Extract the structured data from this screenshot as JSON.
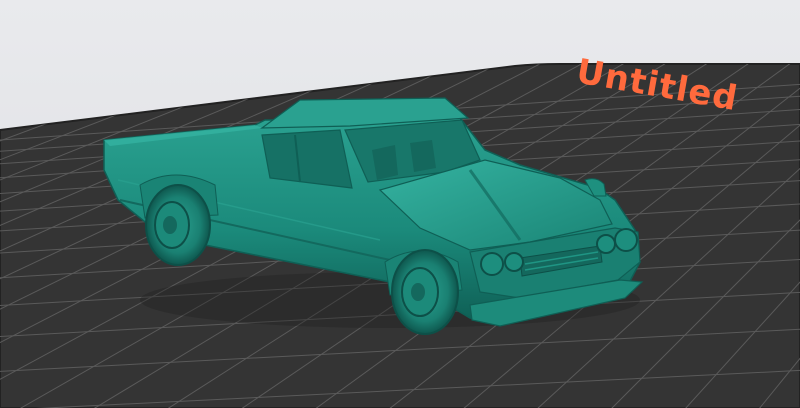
{
  "scene": {
    "plate_label": "Untitled",
    "colors": {
      "background": "#e6e7ea",
      "build_plate": "#343434",
      "plate_edge": "#222222",
      "grid_line": "#5a5a5a",
      "label_color": "#ff6a3d",
      "model_base": "#1b8a7b",
      "model_shadow": "#0f5f55",
      "model_highlight": "#35b3a1"
    },
    "model": {
      "name": "pickup-truck-model",
      "icon": "car-model-icon"
    }
  }
}
